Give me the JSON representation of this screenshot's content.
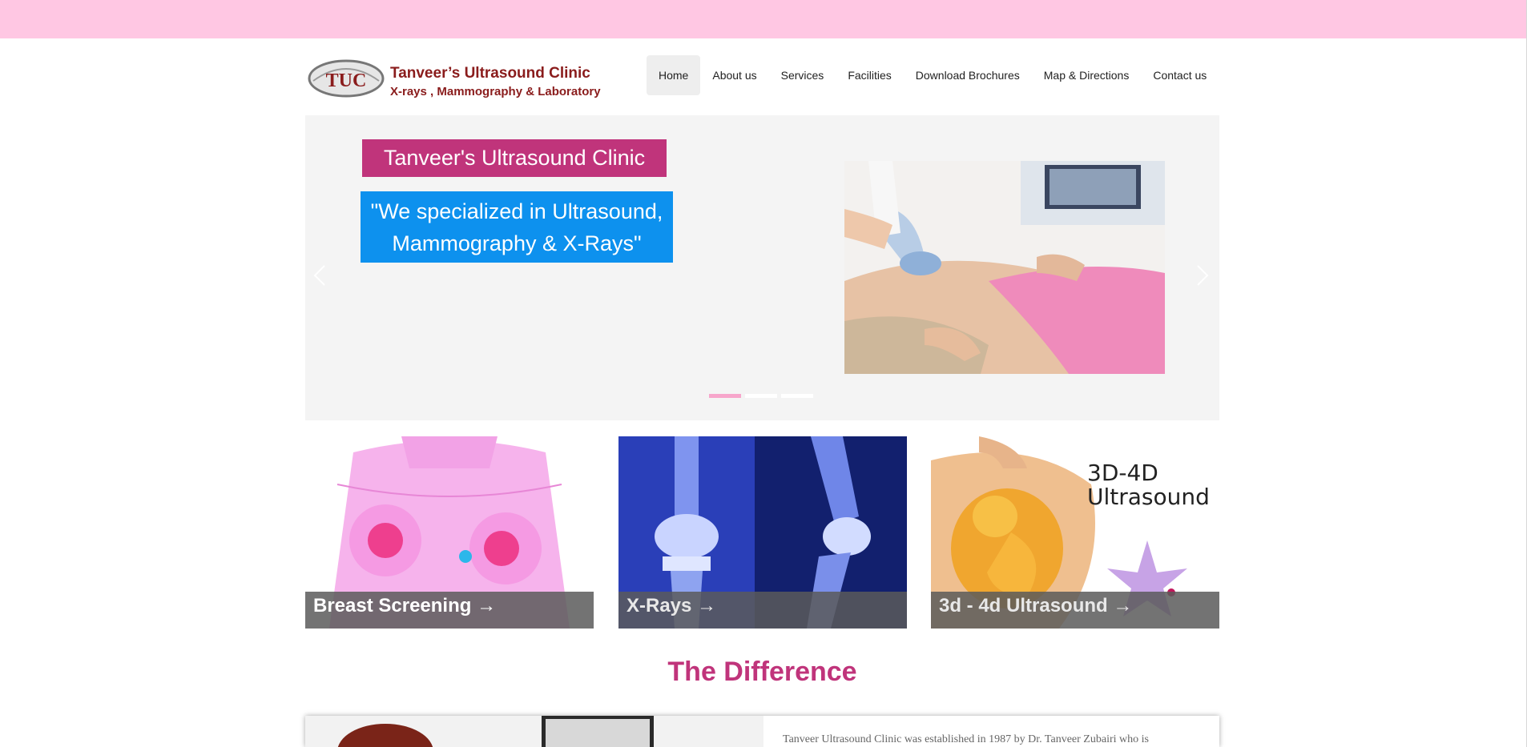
{
  "header": {
    "logo_initials": "TUC",
    "logo_name": "Tanveer’s Ultrasound Clinic",
    "logo_subtitle": "X-rays , Mammography & Laboratory"
  },
  "nav": {
    "items": [
      {
        "label": "Home",
        "active": true
      },
      {
        "label": "About us",
        "active": false
      },
      {
        "label": "Services",
        "active": false
      },
      {
        "label": "Facilities",
        "active": false
      },
      {
        "label": "Download Brochures",
        "active": false
      },
      {
        "label": "Map & Directions",
        "active": false
      },
      {
        "label": "Contact us",
        "active": false
      }
    ]
  },
  "slider": {
    "title": "Tanveer's Ultrasound Clinic",
    "tagline_line1": "\"We specialized in Ultrasound,",
    "tagline_line2": "Mammography & X-Rays\"",
    "prev_icon": "chevron-left-icon",
    "next_icon": "chevron-right-icon",
    "slide_count": 3,
    "active_slide": 1
  },
  "tiles": [
    {
      "caption": "Breast Screening →"
    },
    {
      "caption": "X-Rays →"
    },
    {
      "caption": "3d - 4d Ultrasound →",
      "image_text_line1": "3D-4D",
      "image_text_line2": "Ultrasound"
    }
  ],
  "section": {
    "title": "The Difference"
  },
  "about": {
    "text": "Tanveer Ultrasound Clinic was established in 1987 by Dr. Tanveer Zubairi who is"
  },
  "colors": {
    "topbar": "#ffc7e3",
    "brand_magenta": "#c0347b",
    "brand_blue": "#0d91ee",
    "logo_red": "#8a1c1c",
    "active_dot": "#f7a6cb"
  }
}
